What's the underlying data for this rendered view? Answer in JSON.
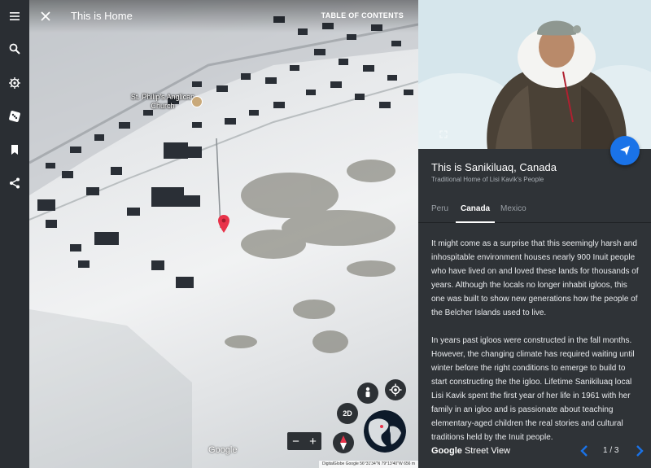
{
  "story": {
    "title": "This is Home",
    "toc_label": "TABLE OF CONTENTS"
  },
  "sidebar": {
    "items": [
      {
        "icon": "menu-icon"
      },
      {
        "icon": "search-icon"
      },
      {
        "icon": "voyager-icon"
      },
      {
        "icon": "dice-icon"
      },
      {
        "icon": "bookmark-icon"
      },
      {
        "icon": "share-icon"
      }
    ]
  },
  "map": {
    "poi_label": "St. Philip's Anglican Church",
    "google_label": "Google",
    "attribution": "DigitalGlobe  Google    56°31'34\"N 79°13'40\"W    656 m",
    "view_toggle": "2D",
    "zoom_in": "+",
    "zoom_out": "−"
  },
  "panel": {
    "title": "This is Sanikiluaq, Canada",
    "subtitle": "Traditional Home of Lisi Kavik's People",
    "tabs": [
      {
        "label": "Peru",
        "active": false
      },
      {
        "label": "Canada",
        "active": true
      },
      {
        "label": "Mexico",
        "active": false
      }
    ],
    "paragraphs": [
      "It might come as a surprise that this seemingly harsh and inhospitable environment houses nearly 900 Inuit people who have lived on and loved these lands for thousands of years. Although the locals no longer inhabit igloos, this one was built to show new generations how the people of the Belcher Islands used to live.",
      "In years past igloos were constructed in the fall months. However, the changing climate has required waiting until winter before the right conditions to emerge to build to start constructing the the igloo. Lifetime Sanikiluaq local Lisi Kavik spent the first year of her life in 1961 with her family in an igloo and is passionate about teaching elementary-aged children the real stories and cultural traditions held by the Inuit people."
    ],
    "brand_google": "Google",
    "brand_streetview": "Street View",
    "page_indicator": "1 / 3"
  },
  "colors": {
    "accent": "#1a73e8",
    "pin": "#e8334a",
    "panel_bg": "#2f3337"
  }
}
